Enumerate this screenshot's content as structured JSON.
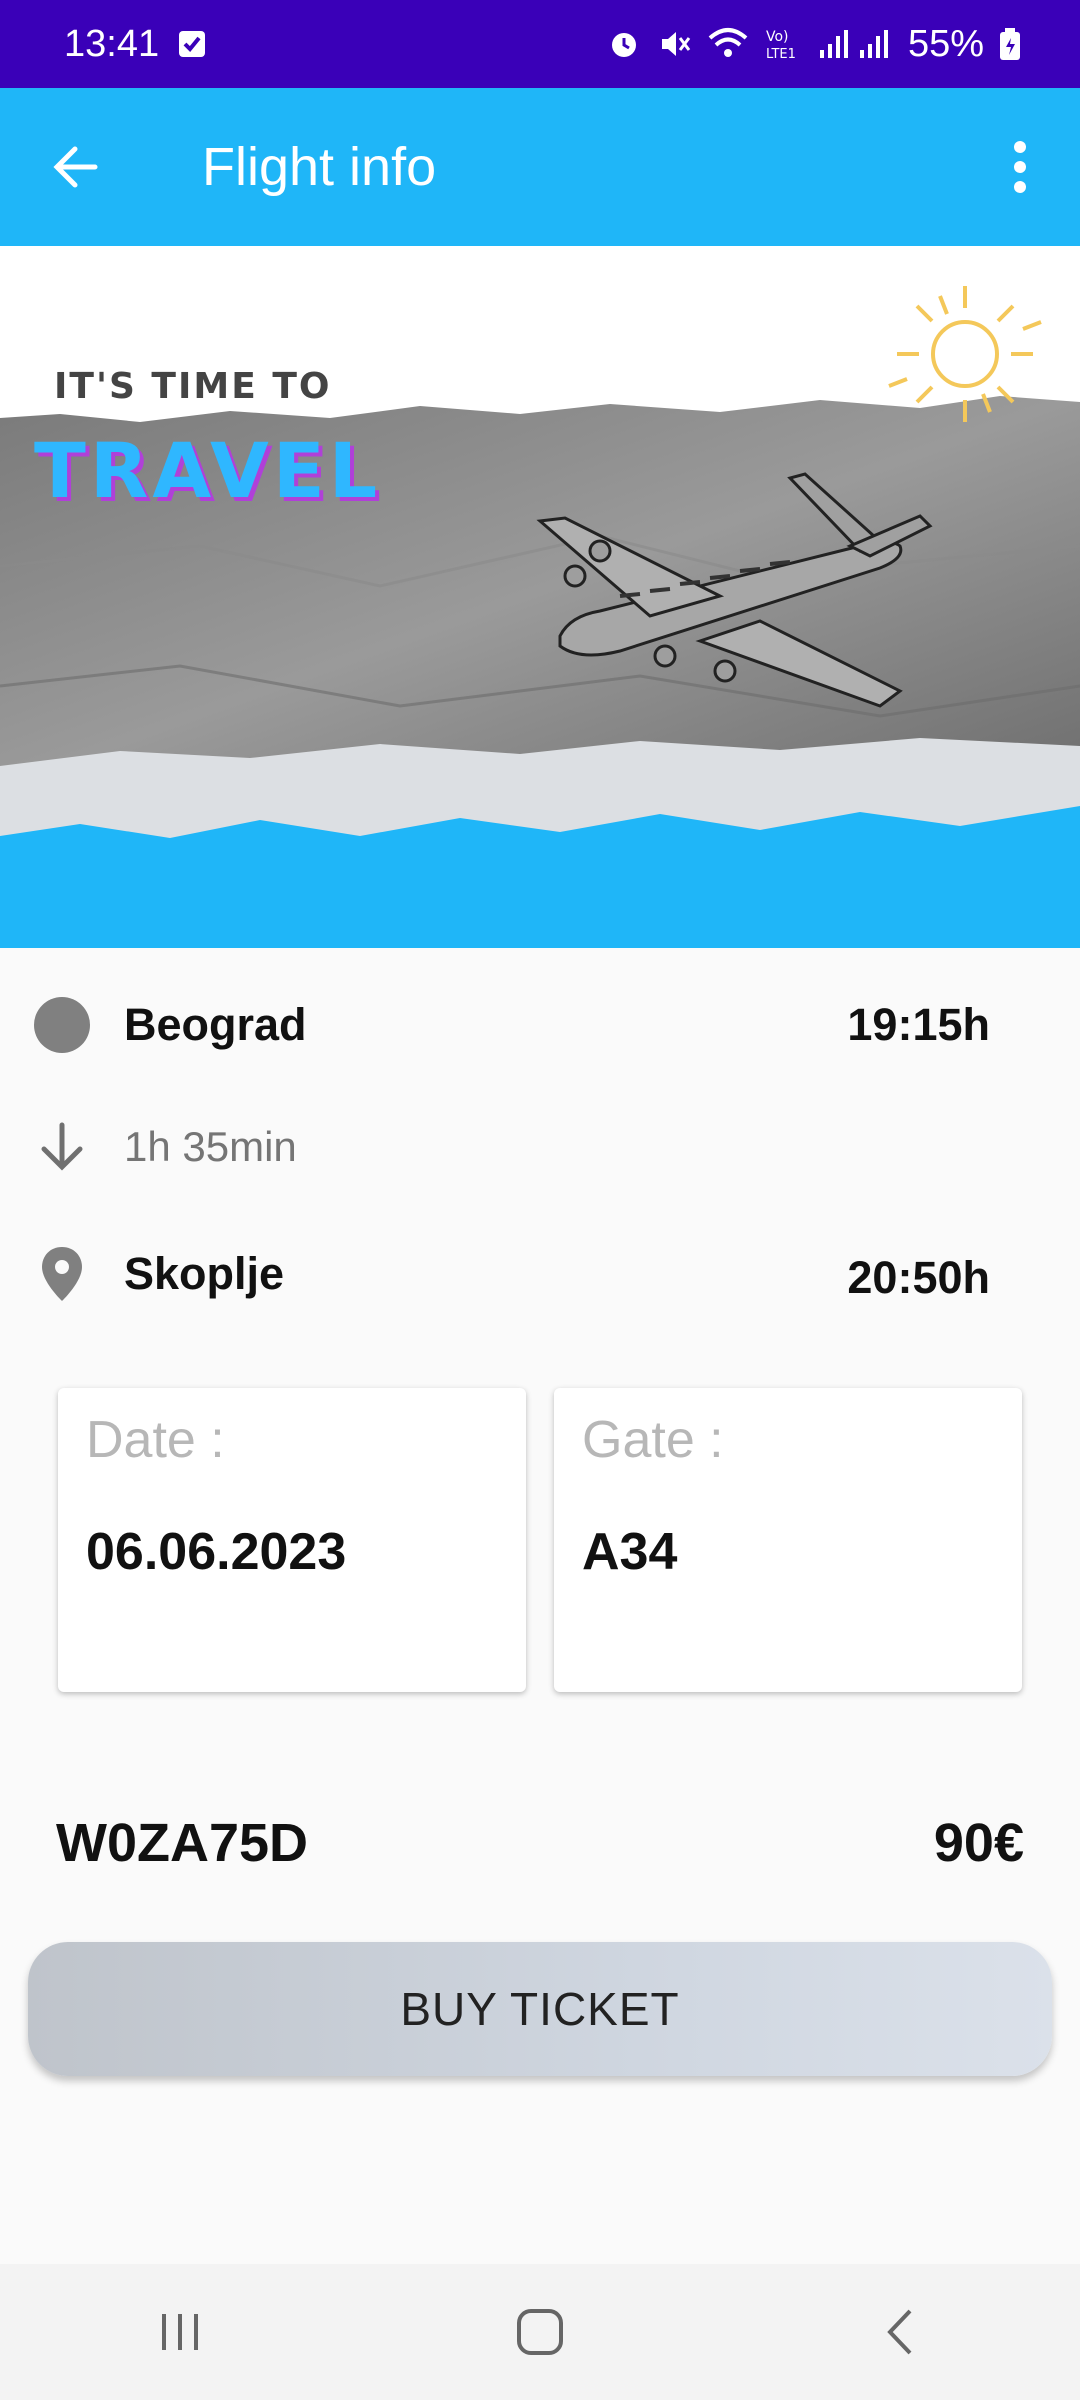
{
  "status_bar": {
    "time": "13:41",
    "battery": "55%",
    "icons": [
      "check-notification-icon",
      "alarm-icon",
      "mute-icon",
      "wifi-icon",
      "volte-icon",
      "signal-icon",
      "battery-icon"
    ]
  },
  "app_bar": {
    "title": "Flight info",
    "back_icon": "arrow-back-icon",
    "menu_icon": "more-vert-icon",
    "color": "#1fb6f8"
  },
  "banner": {
    "tagline": "IT'S TIME TO",
    "headline": "TRAVEL"
  },
  "route": {
    "origin": {
      "city": "Beograd",
      "time": "19:15h"
    },
    "duration": "1h 35min",
    "destination": {
      "city": "Skoplje",
      "time": "20:50h"
    }
  },
  "details": {
    "date_label": "Date :",
    "date_value": "06.06.2023",
    "gate_label": "Gate :",
    "gate_value": "A34"
  },
  "ticket": {
    "code": "W0ZA75D",
    "price": "90€",
    "buy_label": "BUY TICKET"
  },
  "colors": {
    "status_bar": "#3a00b8",
    "accent": "#1fb6f8"
  }
}
